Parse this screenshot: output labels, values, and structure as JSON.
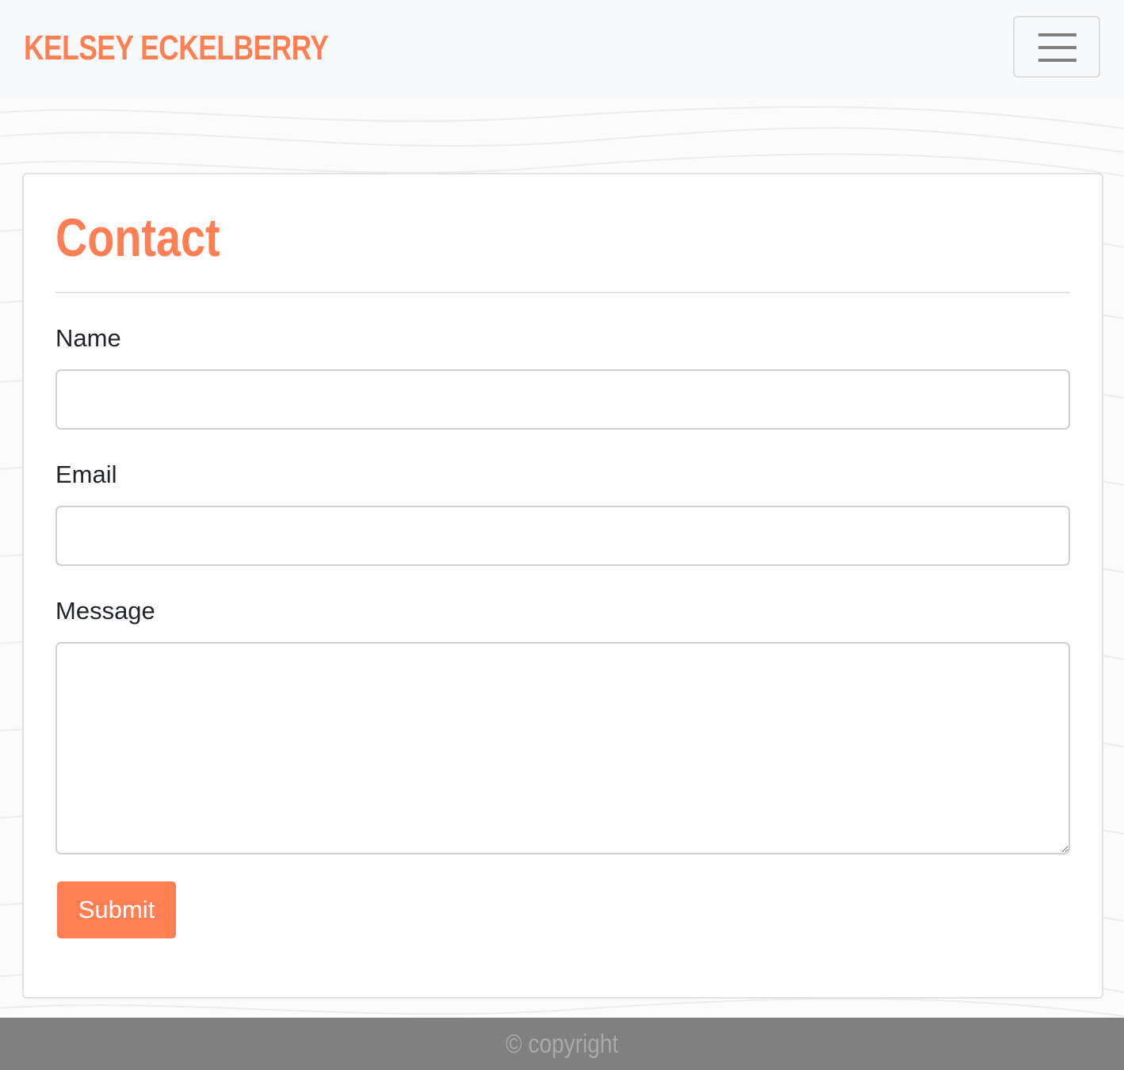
{
  "colors": {
    "accent": "#ff7f55",
    "footer_background": "#808080",
    "footer_text": "#a9a9a9",
    "heading": "#ff7f55"
  },
  "navbar": {
    "brand": "KELSEY ECKELBERRY",
    "toggler_icon": "hamburger-menu-icon"
  },
  "contact_form": {
    "title": "Contact",
    "fields": {
      "name": {
        "label": "Name",
        "value": ""
      },
      "email": {
        "label": "Email",
        "value": ""
      },
      "message": {
        "label": "Message",
        "value": ""
      }
    },
    "submit_label": "Submit"
  },
  "footer": {
    "text": "© copyright"
  }
}
